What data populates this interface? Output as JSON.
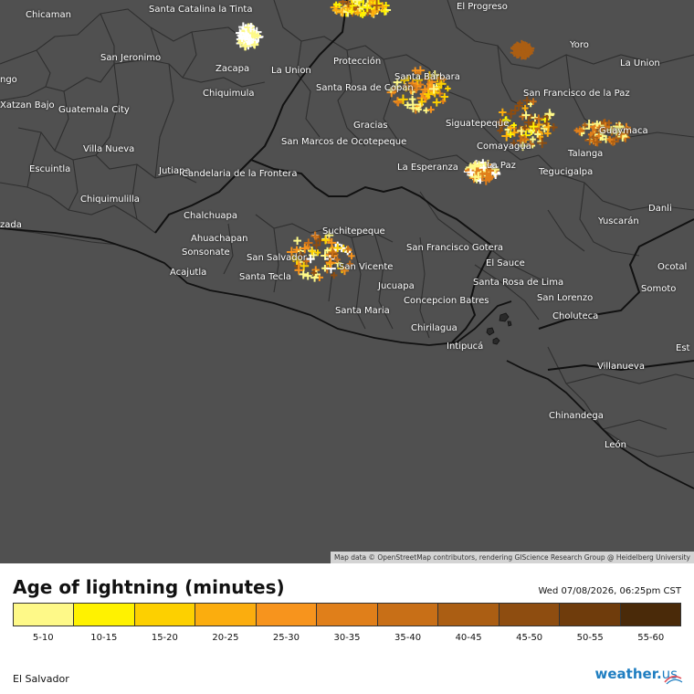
{
  "map": {
    "attribution": "Map data © OpenStreetMap contributors, rendering GIScience Research Group @ Heidelberg University",
    "colors": {
      "land": "#505050",
      "sea": "#505050",
      "border_country": "#111111",
      "border_dept": "#2f2f2f",
      "label": "#ffffff"
    },
    "cities": [
      {
        "name": "Chicaman"
      },
      {
        "name": "Santa Catalina la Tinta"
      },
      {
        "name": "El Progreso"
      },
      {
        "name": "San Jeronimo"
      },
      {
        "name": "Zacapa"
      },
      {
        "name": "La Union"
      },
      {
        "name": "Protección"
      },
      {
        "name": "Santa Bárbara"
      },
      {
        "name": "Yoro"
      },
      {
        "name": "La Union"
      },
      {
        "name": "ngo"
      },
      {
        "name": "Xatzan Bajo"
      },
      {
        "name": "Chiquimula"
      },
      {
        "name": "Santa Rosa de Copán"
      },
      {
        "name": "San Francisco de la Paz"
      },
      {
        "name": "Guatemala City"
      },
      {
        "name": "Gracias"
      },
      {
        "name": "Siguatepeque"
      },
      {
        "name": "Guaymaca"
      },
      {
        "name": "Villa Nueva"
      },
      {
        "name": "San Marcos de Ocotepeque"
      },
      {
        "name": "Comayagua"
      },
      {
        "name": "Talanga"
      },
      {
        "name": "Escuintla"
      },
      {
        "name": "Jutiapa"
      },
      {
        "name": "La Esperanza"
      },
      {
        "name": "La Paz"
      },
      {
        "name": "Candelaria de la Frontera"
      },
      {
        "name": "Tegucigalpa"
      },
      {
        "name": "Chiquimulilla"
      },
      {
        "name": "Danli"
      },
      {
        "name": "Chalchuapa"
      },
      {
        "name": "Yuscarán"
      },
      {
        "name": "zada"
      },
      {
        "name": "Suchitepeque"
      },
      {
        "name": "Ahuachapan"
      },
      {
        "name": "Sonsonate"
      },
      {
        "name": "San Salvador"
      },
      {
        "name": "San Vicente"
      },
      {
        "name": "San Francisco Gotera"
      },
      {
        "name": "El Sauce"
      },
      {
        "name": "Ocotal"
      },
      {
        "name": "Acajutla"
      },
      {
        "name": "Santa Tecla"
      },
      {
        "name": "Santa Rosa de Lima"
      },
      {
        "name": "Jucuapa"
      },
      {
        "name": "Somoto"
      },
      {
        "name": "San Lorenzo"
      },
      {
        "name": "Concepcion Batres"
      },
      {
        "name": "Santa Maria"
      },
      {
        "name": "Choluteca"
      },
      {
        "name": "Chirilagua"
      },
      {
        "name": "Intipucá"
      },
      {
        "name": "Villanueva"
      },
      {
        "name": "Est"
      },
      {
        "name": "Chinandega"
      },
      {
        "name": "León"
      }
    ],
    "lightning_clusters": [
      {
        "area": "north-coast",
        "ages": [
          "5-10",
          "10-15",
          "20-25",
          "40-45"
        ]
      },
      {
        "area": "zacapa",
        "ages": [
          "0-5",
          "5-10"
        ]
      },
      {
        "area": "santa-barbara",
        "ages": [
          "5-10",
          "15-20",
          "25-30",
          "30-35"
        ]
      },
      {
        "area": "yoro",
        "ages": [
          "40-45"
        ]
      },
      {
        "area": "comayagua",
        "ages": [
          "5-10",
          "10-15",
          "20-25",
          "35-40",
          "45-50"
        ]
      },
      {
        "area": "guaymaca",
        "ages": [
          "30-35",
          "40-45",
          "5-10"
        ]
      },
      {
        "area": "la-paz",
        "ages": [
          "0-5",
          "30-35",
          "5-10"
        ]
      },
      {
        "area": "san-salvador",
        "ages": [
          "0-5",
          "5-10",
          "15-20",
          "25-30",
          "35-40",
          "45-50"
        ]
      }
    ]
  },
  "legend": {
    "title": "Age of lightning (minutes)",
    "timestamp": "Wed 07/08/2026, 06:25pm CST",
    "bins": [
      {
        "label": "5-10",
        "color": "#fef988"
      },
      {
        "label": "10-15",
        "color": "#fff200"
      },
      {
        "label": "15-20",
        "color": "#fdd000"
      },
      {
        "label": "20-25",
        "color": "#fbad0e"
      },
      {
        "label": "25-30",
        "color": "#f7941d"
      },
      {
        "label": "30-35",
        "color": "#e07f1a"
      },
      {
        "label": "35-40",
        "color": "#c86f17"
      },
      {
        "label": "40-45",
        "color": "#ab5e13"
      },
      {
        "label": "45-50",
        "color": "#8e4d10"
      },
      {
        "label": "50-55",
        "color": "#6f3c0c"
      },
      {
        "label": "55-60",
        "color": "#4a2a09"
      }
    ],
    "region": "El Salvador",
    "brand": {
      "name": "weather.",
      "tld": "us",
      "color": "#1f7ec1"
    }
  }
}
